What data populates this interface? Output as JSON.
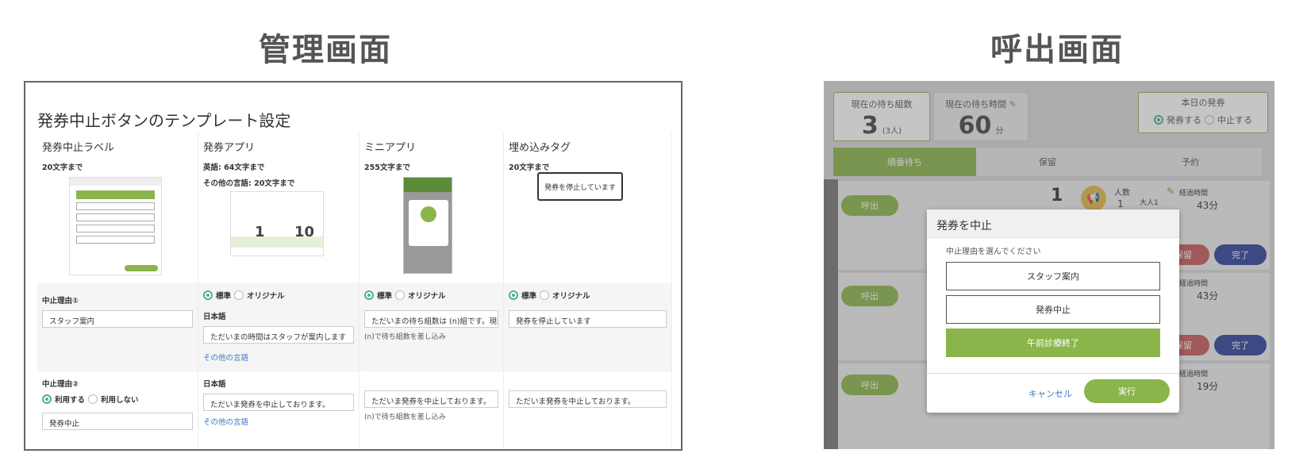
{
  "headings": {
    "admin": "管理画面",
    "call": "呼出画面"
  },
  "admin": {
    "title": "発券中止ボタンのテンプレート設定",
    "columns": [
      {
        "title": "発券中止ラベル",
        "limit": "20文字まで"
      },
      {
        "title": "発券アプリ",
        "limit": "英語: 64文字まで",
        "limit2": "その他の言語: 20文字まで"
      },
      {
        "title": "ミニアプリ",
        "limit": "255文字まで"
      },
      {
        "title": "埋め込みタグ",
        "limit": "20文字まで"
      }
    ],
    "tag_preview": "発券を停止しています",
    "app_preview": {
      "n1": "1",
      "n2": "10"
    },
    "reason1": {
      "label": "中止理由①",
      "value": "スタッフ案内",
      "app": {
        "std": "標準",
        "orig": "オリジナル",
        "lang": "日本語",
        "value": "ただいまの時間はスタッフが案内します",
        "other": "その他の言語"
      },
      "mini": {
        "std": "標準",
        "orig": "オリジナル",
        "value": "ただいまの待ち組数は (n)組です。現在",
        "note": "(n)で待ち組数を差し込み"
      },
      "tag": {
        "std": "標準",
        "orig": "オリジナル",
        "value": "発券を停止しています"
      }
    },
    "reason2": {
      "label": "中止理由②",
      "use": "利用する",
      "nouse": "利用しない",
      "value": "発券中止",
      "app": {
        "lang": "日本語",
        "value": "ただいま発券を中止しております。",
        "other": "その他の言語"
      },
      "mini": {
        "value": "ただいま発券を中止しております。",
        "note": "(n)で待ち組数を差し込み"
      },
      "tag": {
        "value": "ただいま発券を中止しております。"
      }
    }
  },
  "call": {
    "wait_groups": {
      "label": "現在の待ち組数",
      "value": "3",
      "sub": "(3人)"
    },
    "wait_time": {
      "label": "現在の待ち時間",
      "value": "60",
      "unit": "分"
    },
    "today": {
      "label": "本日の発券",
      "on": "発券する",
      "off": "中止する"
    },
    "tabs": [
      "順番待ち",
      "保留",
      "予約"
    ],
    "rows": [
      {
        "call": "呼出",
        "num": "1",
        "people_label": "人数",
        "people": "1",
        "adult": "大人1",
        "elapsed_label": "経過時間",
        "elapsed": "43分",
        "hold": "保留",
        "done": "完了"
      },
      {
        "call": "呼出",
        "elapsed_label": "経過時間",
        "elapsed": "43分",
        "hold": "保留",
        "done": "完了"
      },
      {
        "call": "呼出",
        "elapsed_label": "経過時間",
        "elapsed": "19分"
      }
    ],
    "modal": {
      "title": "発券を中止",
      "prompt": "中止理由を選んでください",
      "options": [
        "スタッフ案内",
        "発券中止",
        "午前診療終了"
      ],
      "cancel": "キャンセル",
      "execute": "実行"
    }
  },
  "colors": {
    "accent": "#8ab54b",
    "teal": "#4caf95",
    "link": "#3a79c6",
    "red": "#c85a5a",
    "navy": "#2f4199"
  }
}
